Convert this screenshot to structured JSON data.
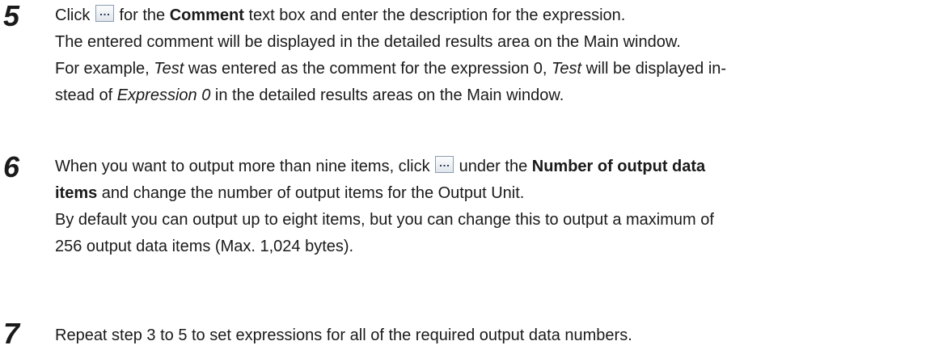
{
  "steps": [
    {
      "number": "5",
      "lines": {
        "l1_a": "Click ",
        "l1_b": " for the ",
        "l1_bold": "Comment",
        "l1_c": " text box and enter the description for the expression.",
        "l2": "The entered comment will be displayed in the detailed results area on the Main window.",
        "l3_a": "For example, ",
        "l3_i1": "Test",
        "l3_b": " was entered as the comment for the expression 0, ",
        "l3_i2": "Test",
        "l3_c": " will be displayed in-",
        "l4_a": "stead of ",
        "l4_i": "Expression 0",
        "l4_b": " in the detailed results areas on the Main window."
      }
    },
    {
      "number": "6",
      "lines": {
        "l1_a": "When you want to output more than nine items, click ",
        "l1_b": " under the ",
        "l1_bold": "Number of output data",
        "l2_bold": "items",
        "l2_a": " and change the number of output items for the Output Unit.",
        "l3": "By default you can output up to eight items, but you can change this to output a maximum of",
        "l4": "256 output data items (Max. 1,024 bytes)."
      }
    },
    {
      "number": "7",
      "lines": {
        "l1": "Repeat step 3 to 5 to set expressions for all of the required output data numbers."
      }
    }
  ],
  "icons": {
    "ellipsis_button": "ellipsis-button-icon"
  },
  "colors": {
    "text": "#1a1a1a",
    "button_border": "#8a9bb0",
    "button_fill_top": "#fdfdfd",
    "button_fill_bottom": "#dfe5ec",
    "button_dots": "#2a3a55"
  }
}
